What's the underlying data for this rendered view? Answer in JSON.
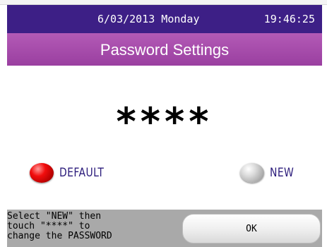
{
  "status": {
    "date": "6/03/2013 Monday",
    "time": "19:46:25"
  },
  "title": "Password Settings",
  "password_display": "****",
  "options": {
    "default_label": "DEFAULT",
    "new_label": "NEW",
    "selected": "DEFAULT"
  },
  "hint_lines": [
    "Select \"NEW\" then",
    "touch \"****\" to",
    "change the PASSWORD"
  ],
  "buttons": {
    "ok_label": "OK"
  },
  "colors": {
    "status_bar": "#3d1f86",
    "title_bar": "#a84cad",
    "footer": "#a9a9a9",
    "selected_indicator": "#e00000",
    "unselected_indicator": "#bdbdbd"
  }
}
